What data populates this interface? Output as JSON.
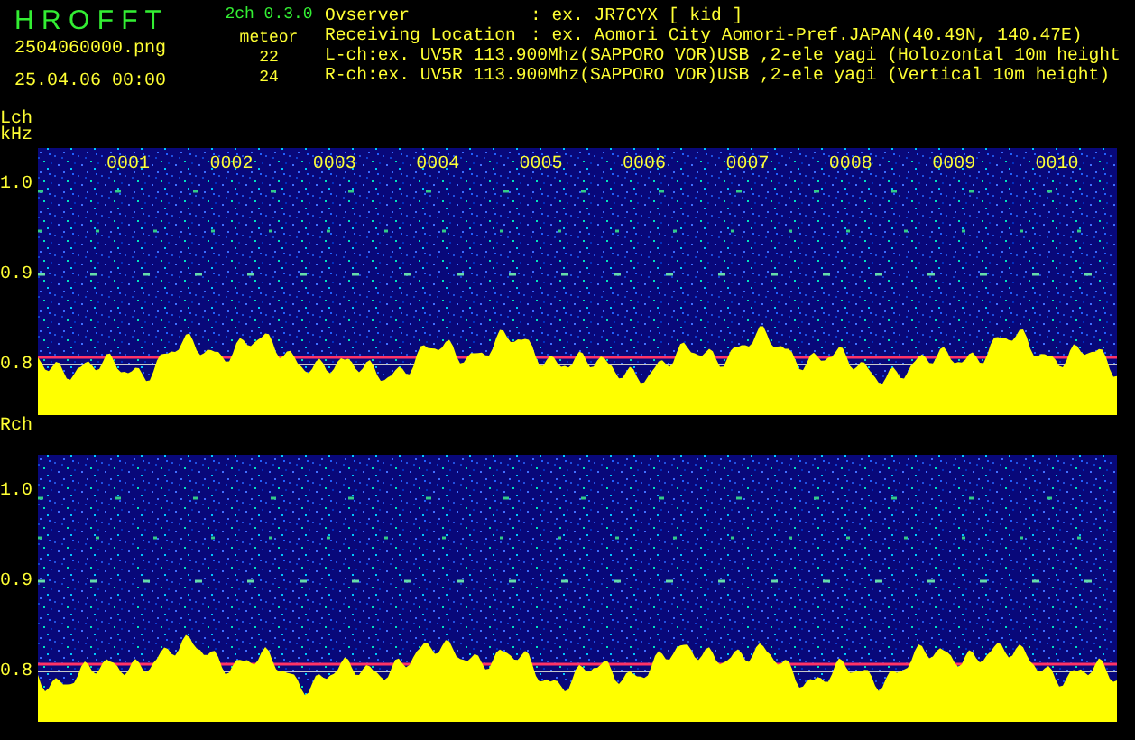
{
  "header": {
    "app_name": "H R O F F T",
    "version": "2ch 0.3.0",
    "file_name": "2504060000.png",
    "date_time": "25.04.06 00:00",
    "count_label": "meteor",
    "counts": [
      "22",
      "24"
    ],
    "info_lines": [
      {
        "kind": "field",
        "label": "Ovserver",
        "value": ": ex. JR7CYX [ kid ]"
      },
      {
        "kind": "field",
        "label": "Receiving Location",
        "value": ": ex. Aomori City Aomori-Pref.JAPAN(40.49N, 140.47E)"
      },
      {
        "kind": "line",
        "value": "L-ch:ex. UV5R 113.900Mhz(SAPPORO VOR)USB ,2-ele yagi (Holozontal 10m height"
      },
      {
        "kind": "line",
        "value": "R-ch:ex. UV5R 113.900Mhz(SAPPORO VOR)USB ,2-ele yagi (Vertical 10m height)"
      }
    ]
  },
  "channels": [
    {
      "label": "Lch",
      "unit": "kHz",
      "ticks": [
        "1.0",
        "0.9",
        "0.8"
      ],
      "time_labels": [
        "0001",
        "0002",
        "0003",
        "0004",
        "0005",
        "0006",
        "0007",
        "0008",
        "0009",
        "0010"
      ]
    },
    {
      "label": "Rch",
      "ticks": [
        "1.0",
        "0.9",
        "0.8"
      ]
    }
  ]
}
